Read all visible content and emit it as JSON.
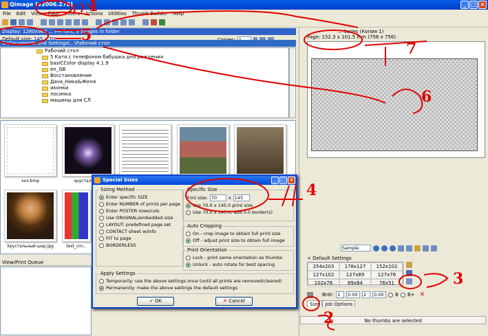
{
  "window": {
    "title": "Qimage [v2006.278]"
  },
  "menu": [
    "File",
    "Edit",
    "View",
    "Page",
    "Filters",
    "Actions",
    "Utilities",
    "Thumb Builder",
    "Help"
  ],
  "display_bar": "Display: 1280x960 ... PPI font, 9 images in folder",
  "default_size": {
    "label": "Default size:",
    "value": "145 x 70"
  },
  "copies": {
    "label": "Copies:",
    "value": "1"
  },
  "path": "C:\\Documents and Settings\\...\\Рабочий стол",
  "tree": [
    "Рабочий стол",
    "5 Катя с телефоном бабушка дня рождения",
    "basICColor display 4.1.9",
    "en_GB",
    "Восстановление",
    "Дача_Ника&Женя",
    "иконки",
    "лосинка",
    "машины для СЛ"
  ],
  "thumbnails": [
    {
      "label": "xxx.bmp"
    },
    {
      "label": "хрустальный"
    },
    {
      "label": ""
    },
    {
      "label": ""
    },
    {
      "label": ""
    },
    {
      "label": "Хрустальный шар.jpg"
    },
    {
      "label": "test_cm..."
    }
  ],
  "queue_title": "View/Print Queue",
  "printer": {
    "name": "... Series (Копия 1)",
    "page": "Page: 152.3 x 101.5 mm (756 x 756)"
  },
  "sample_select": "Sample",
  "default_settings": {
    "title": "< Default Settings",
    "sizes": [
      "254x203",
      "178x127",
      "152x102",
      "127x102",
      "127x89",
      "127x76",
      "102x76",
      "89x64",
      "76x51"
    ]
  },
  "border": {
    "label": "Brdr:",
    "v1": "1",
    "v2": "0.00",
    "v3": "2",
    "v4": "0.00",
    "b_label": "B",
    "bplus_label": "B+"
  },
  "tabs": [
    "Size",
    "Job Options"
  ],
  "status": "No thumbs are selected",
  "dialog": {
    "title": "Special Sizes",
    "sizing_method": {
      "legend": "Sizing Method",
      "options": [
        "Enter specific SIZE",
        "Enter NUMBER of prints per page",
        "Enter POSTER rows/cols",
        "Use ORIGINAL/embedded size",
        "LAYOUT: predefined page set",
        "CONTACT sheet w/info",
        "FIT to page",
        "BORDERLESS"
      ]
    },
    "specific_size": {
      "legend": "Specific Size",
      "print_size_label": "Print size:",
      "width": "70",
      "x_label": "x",
      "height": "145",
      "options": [
        "Use 70.0 x 145.0 print size",
        "Use 70.0 x 145.0, add 0.0 border(s)"
      ]
    },
    "auto_cropping": {
      "legend": "Auto Cropping",
      "options": [
        "On - crop image to obtain full print size",
        "Off - adjust print size to obtain full image"
      ]
    },
    "print_orientation": {
      "legend": "Print Orientation",
      "options": [
        "Lock - print same orientation as thumbs",
        "Unlock - auto rotate for best spacing"
      ]
    },
    "apply": {
      "legend": "Apply Settings",
      "options": [
        "Temporarily: use the above settings once (until all prints are removed/cleared)",
        "Permanently: make the above settings the default settings"
      ]
    },
    "ok": "OK",
    "cancel": "Cancel"
  },
  "annotations": [
    "1",
    "2",
    "3",
    "4",
    "5",
    "6",
    "7"
  ]
}
